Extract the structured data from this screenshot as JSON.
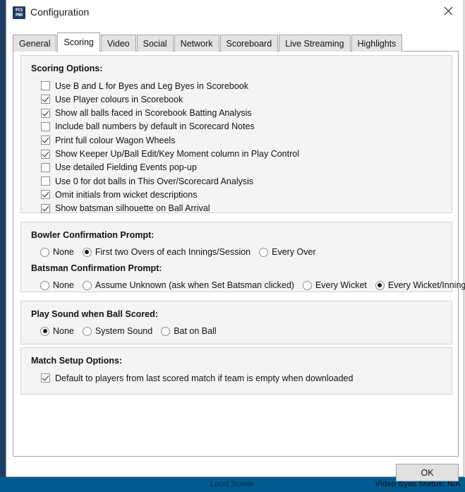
{
  "background_app": {
    "status_left": "Local Scorer",
    "status_right": "Video Sync Status: N/A"
  },
  "dialog": {
    "title": "Configuration",
    "icon_line1": "PCS",
    "icon_line2": "PRO",
    "close_label": "Close",
    "ok_label": "OK"
  },
  "tabs": [
    {
      "label": "General",
      "active": false
    },
    {
      "label": "Scoring",
      "active": true
    },
    {
      "label": "Video",
      "active": false
    },
    {
      "label": "Social",
      "active": false
    },
    {
      "label": "Network",
      "active": false
    },
    {
      "label": "Scoreboard",
      "active": false
    },
    {
      "label": "Live Streaming",
      "active": false
    },
    {
      "label": "Highlights",
      "active": false
    }
  ],
  "groups": {
    "scoring_options": {
      "title": "Scoring Options:",
      "checkboxes": [
        {
          "label": "Use B and L for Byes and Leg Byes in Scorebook",
          "checked": false
        },
        {
          "label": "Use Player colours in Scorebook",
          "checked": true
        },
        {
          "label": "Show all balls faced in Scorebook Batting Analysis",
          "checked": true
        },
        {
          "label": "Include ball numbers by default in Scorecard Notes",
          "checked": false
        },
        {
          "label": "Print full colour Wagon Wheels",
          "checked": true
        },
        {
          "label": "Show Keeper Up/Ball Edit/Key Moment column in Play Control",
          "checked": true
        },
        {
          "label": "Use detailed Fielding Events pop-up",
          "checked": false
        },
        {
          "label": "Use 0 for dot balls in This Over/Scorecard Analysis",
          "checked": false
        },
        {
          "label": "Omit initials from wicket descriptions",
          "checked": true
        },
        {
          "label": "Show batsman silhouette on Ball Arrival",
          "checked": true
        }
      ]
    },
    "confirmation_prompts": {
      "bowler_title": "Bowler Confirmation Prompt:",
      "bowler_options": [
        {
          "label": "None",
          "selected": false
        },
        {
          "label": "First two Overs of each Innings/Session",
          "selected": true
        },
        {
          "label": "Every Over",
          "selected": false
        }
      ],
      "batsman_title": "Batsman Confirmation Prompt:",
      "batsman_options": [
        {
          "label": "None",
          "selected": false
        },
        {
          "label": "Assume Unknown (ask when Set Batsman clicked)",
          "selected": false
        },
        {
          "label": "Every Wicket",
          "selected": false
        },
        {
          "label": "Every Wicket/Innings Start",
          "selected": true
        }
      ]
    },
    "play_sound": {
      "title": "Play Sound when Ball Scored:",
      "options": [
        {
          "label": "None",
          "selected": true
        },
        {
          "label": "System Sound",
          "selected": false
        },
        {
          "label": "Bat on Ball",
          "selected": false
        }
      ]
    },
    "match_setup": {
      "title": "Match Setup Options:",
      "checkboxes": [
        {
          "label": "Default to players from last scored match if team is empty when downloaded",
          "checked": true
        }
      ]
    }
  }
}
